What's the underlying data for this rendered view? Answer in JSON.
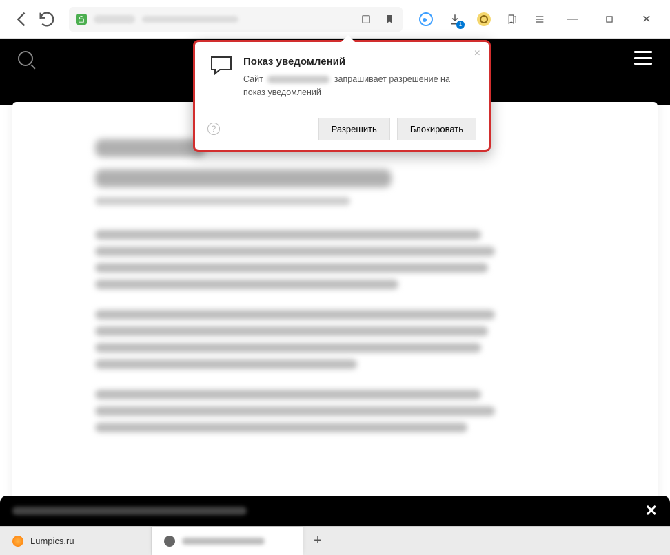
{
  "toolbar": {
    "download_badge": "1"
  },
  "tabs": {
    "tab1_label": "Lumpics.ru",
    "newtab_label": "+"
  },
  "dialog": {
    "title": "Показ уведомлений",
    "desc_before": "Сайт",
    "desc_after": "запрашивает разрешение на показ уведомлений",
    "allow_label": "Разрешить",
    "block_label": "Блокировать",
    "help_char": "?",
    "close_char": "×"
  },
  "cookie": {
    "close_char": "✕"
  }
}
